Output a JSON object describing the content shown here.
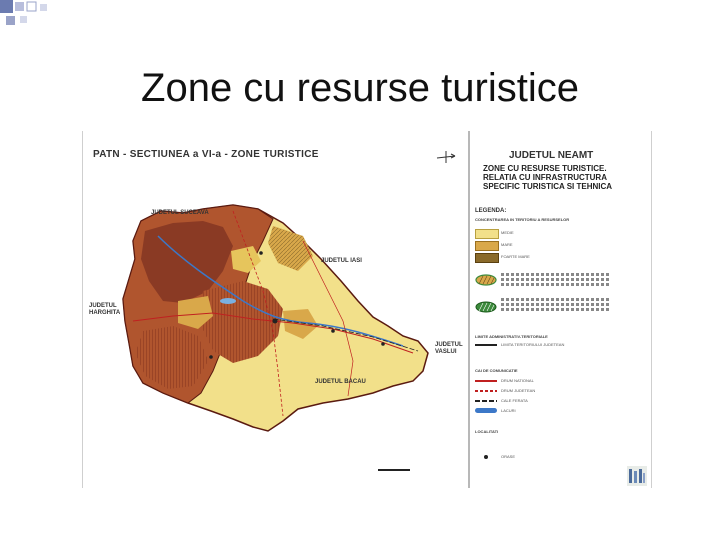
{
  "slide": {
    "title": "Zone cu resurse turistice"
  },
  "map": {
    "header": "PATN - SECTIUNEA a VI-a - ZONE TURISTICE",
    "county_labels": {
      "suceava": "JUDETUL SUCEAVA",
      "iasi": "JUDETUL IASI",
      "harghita_line1": "JUDETUL",
      "harghita_line2": "HARGHITA",
      "vaslui_line1": "JUDETUL",
      "vaslui_line2": "VASLUI",
      "bacau": "JUDETUL BACAU"
    },
    "colors": {
      "low": "#f2e08a",
      "medium": "#d9a84a",
      "high": "#8a3a24",
      "very_high": "#b0552e",
      "outline": "#5a1a10"
    }
  },
  "legend": {
    "county": "JUDETUL NEAMT",
    "title_lines": [
      "ZONE CU RESURSE TURISTICE.",
      "RELATIA  CU  INFRASTRUCTURA",
      "SPECIFIC TURISTICA SI TEHNICA"
    ],
    "legenda_label": "LEGENDA:",
    "section_concentration": "CONCENTRAREA IN TERITORIU A RESURSELOR",
    "levels": [
      "MEDIE",
      "MARE",
      "FOARTE MARE"
    ],
    "section_admin": "LIMITE ADMINISTRATIV-TERITORIALE",
    "admin_items": [
      "LIMITA TERITORIULUI JUDETEAN"
    ],
    "section_roads": "CAI DE COMUNICATIE",
    "road_items": [
      "DRUM NATIONAL",
      "DRUM JUDETEAN",
      "CALE FERATA",
      "LACURI"
    ],
    "section_localities": "LOCALITATI",
    "locality_items": [
      "ORASE"
    ]
  }
}
